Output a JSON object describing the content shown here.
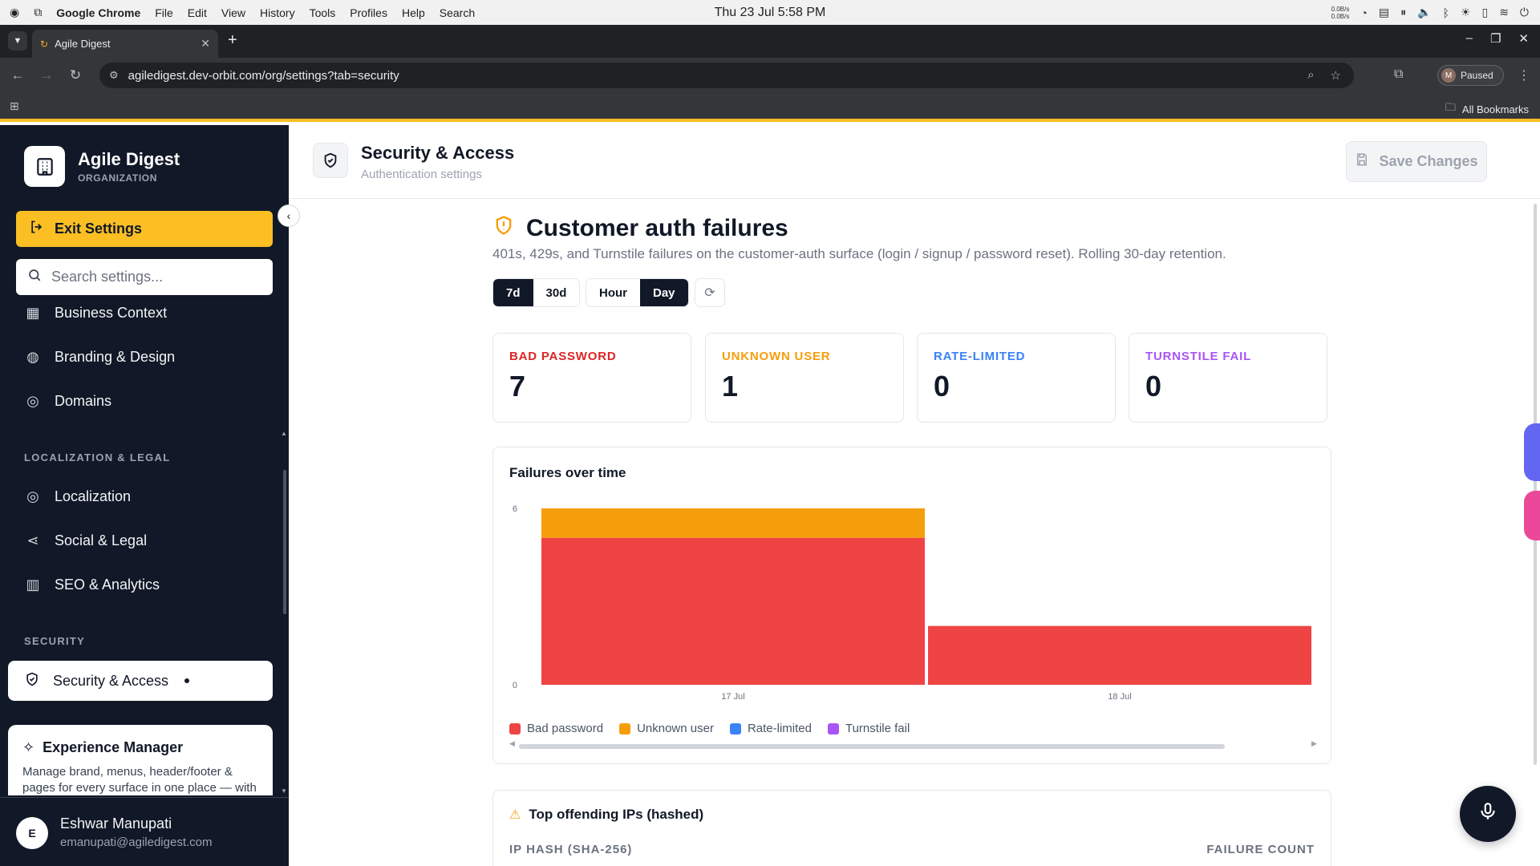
{
  "os": {
    "app_name": "Google Chrome",
    "menus": [
      "File",
      "Edit",
      "View",
      "History",
      "Tools",
      "Profiles",
      "Help",
      "Search"
    ],
    "clock": "Thu 23 Jul  5:58 PM",
    "net_up": "0.0B/s",
    "net_down": "0.0B/s"
  },
  "browser": {
    "tab_title": "Agile Digest",
    "url": "agiledigest.dev-orbit.com/org/settings?tab=security",
    "profile_initial": "M",
    "profile_status": "Paused",
    "bookmarks_label": "All Bookmarks"
  },
  "sidebar": {
    "brand_name": "Agile Digest",
    "brand_sub": "ORGANIZATION",
    "exit_label": "Exit Settings",
    "search_placeholder": "Search settings...",
    "items_top": [
      {
        "label": "Business Context",
        "icon": "building-icon"
      },
      {
        "label": "Branding & Design",
        "icon": "palette-icon"
      },
      {
        "label": "Domains",
        "icon": "globe-icon"
      }
    ],
    "section_localization": "LOCALIZATION & LEGAL",
    "items_localization": [
      {
        "label": "Localization",
        "icon": "globe-icon"
      },
      {
        "label": "Social & Legal",
        "icon": "share-icon"
      },
      {
        "label": "SEO & Analytics",
        "icon": "bar-chart-icon"
      }
    ],
    "section_security": "SECURITY",
    "active_item": "Security & Access",
    "experience": {
      "title": "Experience Manager",
      "desc": "Manage brand, menus, header/footer & pages for every surface in one place — with"
    },
    "user": {
      "initial": "E",
      "name": "Eshwar Manupati",
      "email": "emanupati@agiledigest.com"
    }
  },
  "header": {
    "title": "Security & Access",
    "subtitle": "Authentication settings",
    "save_label": "Save Changes"
  },
  "section": {
    "title": "Customer auth failures",
    "desc": "401s, 429s, and Turnstile failures on the customer-auth surface (login / signup / password reset). Rolling 30-day retention.",
    "range_options": [
      "7d",
      "30d"
    ],
    "range_selected": "7d",
    "bucket_options": [
      "Hour",
      "Day"
    ],
    "bucket_selected": "Day"
  },
  "stats": [
    {
      "label": "BAD PASSWORD",
      "value": "7",
      "color": "#dc2626"
    },
    {
      "label": "UNKNOWN USER",
      "value": "1",
      "color": "#f59e0b"
    },
    {
      "label": "RATE-LIMITED",
      "value": "0",
      "color": "#3b82f6"
    },
    {
      "label": "TURNSTILE FAIL",
      "value": "0",
      "color": "#a855f7"
    }
  ],
  "chart_data": {
    "type": "bar",
    "stacked": true,
    "title": "Failures over time",
    "categories": [
      "17 Jul",
      "18 Jul"
    ],
    "series": [
      {
        "name": "Bad password",
        "color": "#ef4444",
        "values": [
          5,
          2
        ]
      },
      {
        "name": "Unknown user",
        "color": "#f59e0b",
        "values": [
          1,
          0
        ]
      },
      {
        "name": "Rate-limited",
        "color": "#3b82f6",
        "values": [
          0,
          0
        ]
      },
      {
        "name": "Turnstile fail",
        "color": "#a855f7",
        "values": [
          0,
          0
        ]
      }
    ],
    "yticks": [
      "6",
      "0"
    ],
    "ylim": [
      0,
      6
    ],
    "legend": "bottom-left",
    "grid": false
  },
  "ips": {
    "title": "Top offending IPs (hashed)",
    "col_hash": "IP HASH (SHA-256)",
    "col_count": "FAILURE COUNT"
  }
}
